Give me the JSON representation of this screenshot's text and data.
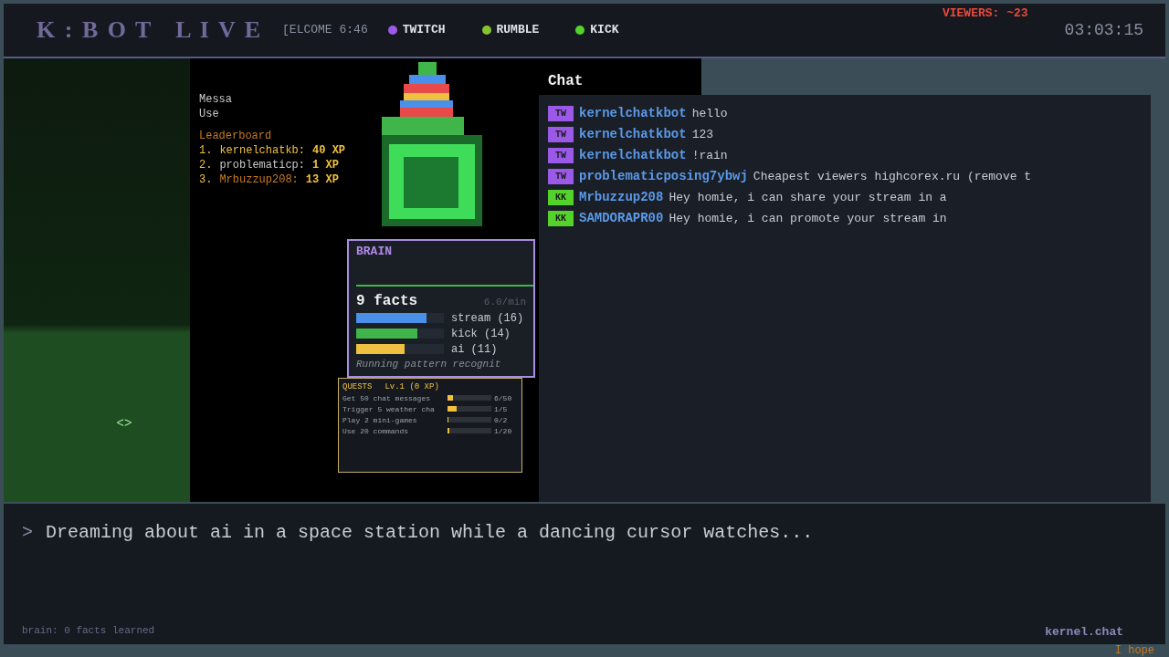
{
  "header": {
    "title": "K : B O T   L I V E",
    "welcome": "[ELCOME 6:46",
    "platforms": [
      {
        "label": "TWITCH",
        "color": "#9b59e8"
      },
      {
        "label": "RUMBLE",
        "color": "#85c232"
      },
      {
        "label": "KICK",
        "color": "#53d22c"
      }
    ],
    "viewers": "VIEWERS: ~23",
    "clock": "03:03:15"
  },
  "scene": {
    "cursor_glyph": "<>"
  },
  "overlay": {
    "stats": [
      "Messa",
      "Use"
    ],
    "leaderboard_title": "Leaderboard",
    "leaderboard": [
      {
        "rank": "1.",
        "name": "kernelchatkb:",
        "xp": "40 XP"
      },
      {
        "rank": "2.",
        "name": "problematicp:",
        "xp": "1 XP"
      },
      {
        "rank": "3.",
        "name": "Mrbuzzup208:",
        "xp": "13 XP"
      }
    ]
  },
  "chat": {
    "title": "Chat",
    "messages": [
      {
        "badge": "TW",
        "color": "#9b59e8",
        "user": "kernelchatkbot",
        "text": "hello"
      },
      {
        "badge": "TW",
        "color": "#9b59e8",
        "user": "kernelchatkbot",
        "text": "123"
      },
      {
        "badge": "TW",
        "color": "#9b59e8",
        "user": "kernelchatkbot",
        "text": "!rain"
      },
      {
        "badge": "TW",
        "color": "#9b59e8",
        "user": "problematicposing7ybwj",
        "text": "Cheapest viewers  highcorex.ru (remove t"
      },
      {
        "badge": "KK",
        "color": "#53d22c",
        "user": "Mrbuzzup208",
        "text": "Hey homie, i can share your stream in a"
      },
      {
        "badge": "KK",
        "color": "#53d22c",
        "user": "SAMDORAPR00",
        "text": "Hey homie, i can promote your stream in"
      }
    ]
  },
  "brain": {
    "title": "BRAIN",
    "facts": "9 facts",
    "rate": "6.0/min",
    "topics": [
      {
        "label": "stream (16)",
        "level": 0.8,
        "color": "#4a8fe8"
      },
      {
        "label": "kick (14)",
        "level": 0.7,
        "color": "#3fb54a"
      },
      {
        "label": "ai (11)",
        "level": 0.55,
        "color": "#f0c040"
      }
    ],
    "status": "Running pattern recognit"
  },
  "quests": {
    "title": "QUESTS",
    "level": "Lv.1 (0 XP)",
    "items": [
      {
        "label": "Get 50 chat messages",
        "level": 0.12,
        "progress": "6/50"
      },
      {
        "label": "Trigger 5 weather cha",
        "level": 0.2,
        "progress": "1/5"
      },
      {
        "label": "Play 2 mini-games",
        "level": 0,
        "progress": "0/2"
      },
      {
        "label": "Use 20 commands",
        "level": 0.05,
        "progress": "1/20"
      }
    ]
  },
  "terminal": {
    "prompt": ">",
    "line": "Dreaming about ai in a space station while a dancing cursor watches...",
    "footer": "brain: 0 facts learned",
    "brand": "kernel.chat",
    "ticker": "I hope"
  }
}
